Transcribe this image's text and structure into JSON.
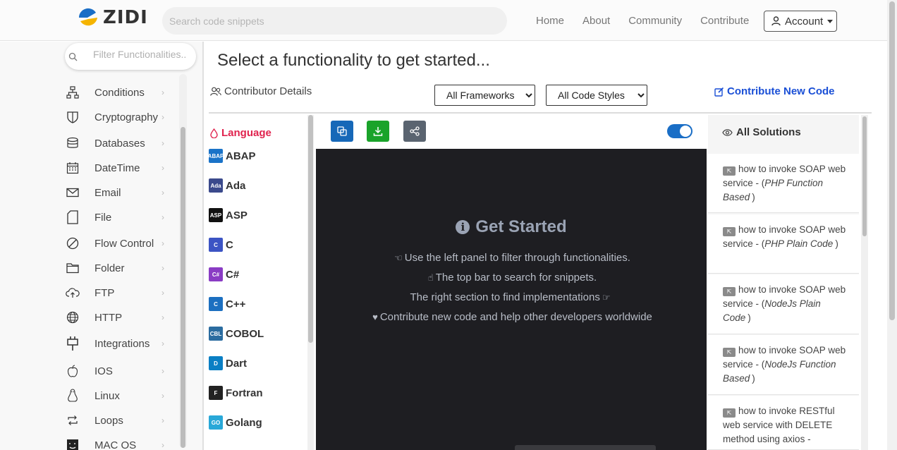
{
  "brand": {
    "name": "ZIDI"
  },
  "search": {
    "placeholder": "Search code snippets"
  },
  "nav": {
    "links": [
      "Home",
      "About",
      "Community",
      "Contribute"
    ],
    "account": "Account"
  },
  "sidebar": {
    "filter_placeholder": "Filter Functionalities..",
    "items": [
      {
        "label": "Conditions",
        "icon": "sitemap-icon"
      },
      {
        "label": "Cryptography",
        "icon": "shield-icon"
      },
      {
        "label": "Databases",
        "icon": "database-icon"
      },
      {
        "label": "DateTime",
        "icon": "calendar-icon"
      },
      {
        "label": "Email",
        "icon": "envelope-icon"
      },
      {
        "label": "File",
        "icon": "file-icon"
      },
      {
        "label": "Flow Control",
        "icon": "ban-icon"
      },
      {
        "label": "Folder",
        "icon": "folder-icon"
      },
      {
        "label": "FTP",
        "icon": "cloud-upload-icon"
      },
      {
        "label": "HTTP",
        "icon": "globe-icon"
      },
      {
        "label": "Integrations",
        "icon": "plug-icon"
      },
      {
        "label": "IOS",
        "icon": "apple-icon"
      },
      {
        "label": "Linux",
        "icon": "linux-icon"
      },
      {
        "label": "Loops",
        "icon": "repeat-icon"
      },
      {
        "label": "MAC OS",
        "icon": "mac-icon"
      }
    ]
  },
  "main": {
    "title": "Select a functionality to get started...",
    "contributor_details": "Contributor Details",
    "framework_select": "All Frameworks",
    "style_select": "All Code Styles",
    "contribute_new": "Contribute New Code"
  },
  "languages": {
    "heading": "Language",
    "items": [
      {
        "name": "ABAP",
        "badge": "ABAP",
        "color": "#1a73c8"
      },
      {
        "name": "Ada",
        "badge": "Ada",
        "color": "#3b4a8c"
      },
      {
        "name": "ASP",
        "badge": "ASP",
        "color": "#111111"
      },
      {
        "name": "C",
        "badge": "C",
        "color": "#3c54c4"
      },
      {
        "name": "C#",
        "badge": "C#",
        "color": "#8a3cc4"
      },
      {
        "name": "C++",
        "badge": "C",
        "color": "#1c6fc0"
      },
      {
        "name": "COBOL",
        "badge": "CBL",
        "color": "#2b6ca0"
      },
      {
        "name": "Dart",
        "badge": "D",
        "color": "#0a7fc4"
      },
      {
        "name": "Fortran",
        "badge": "F",
        "color": "#222222"
      },
      {
        "name": "Golang",
        "badge": "GO",
        "color": "#29a8d8"
      }
    ]
  },
  "code_panel": {
    "get_started_title": "Get Started",
    "lines": [
      "Use the left panel to filter through functionalities.",
      "The top bar to search for snippets.",
      "The right section to find implementations",
      "Contribute new code and help other developers worldwide"
    ],
    "toggle_on": true,
    "button_colors": {
      "copy": "#1668b8",
      "download": "#1aa32a",
      "share": "#5a6470"
    }
  },
  "solutions": {
    "heading": "All Solutions",
    "items": [
      {
        "text": "how to invoke SOAP web service - (",
        "style": "PHP Function Based",
        "suffix": ")"
      },
      {
        "text": "how to invoke SOAP web service - (",
        "style": "PHP Plain Code",
        "suffix": ")"
      },
      {
        "text": "how to invoke SOAP web service - (",
        "style": "NodeJs Plain Code",
        "suffix": ")"
      },
      {
        "text": "how to invoke SOAP web service - (",
        "style": "NodeJs Function Based",
        "suffix": ")"
      },
      {
        "text": "how to invoke RESTful web service with DELETE method using axios -",
        "style": "",
        "suffix": ""
      }
    ]
  }
}
